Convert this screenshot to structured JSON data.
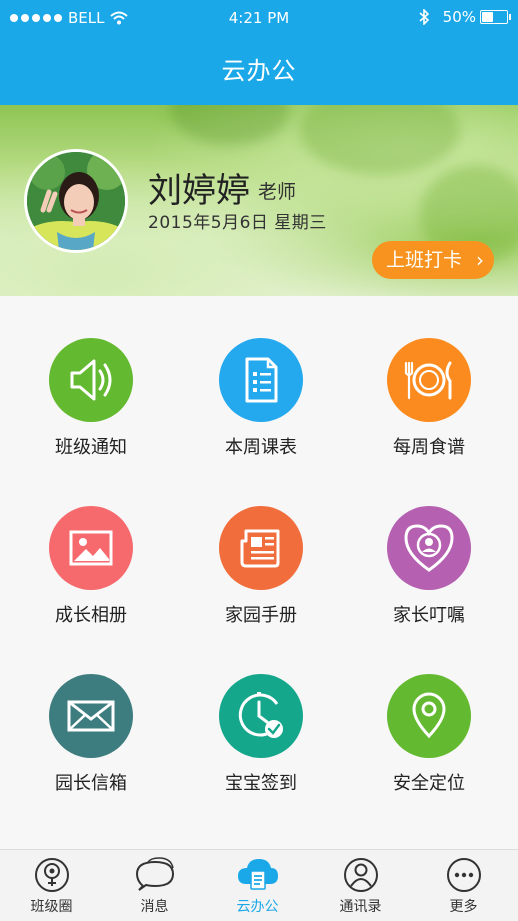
{
  "status_bar": {
    "carrier": "BELL",
    "time": "4:21 PM",
    "battery": "50%",
    "battery_level": 0.5
  },
  "header": {
    "title": "云办公"
  },
  "profile": {
    "name": "刘婷婷",
    "role": "老师",
    "date": "2015年5月6日  星期三",
    "clock_in_label": "上班打卡"
  },
  "colors": {
    "primary": "#1aa8e8",
    "orange": "#f7931e"
  },
  "grid": [
    {
      "label": "班级通知",
      "icon": "speaker-icon",
      "color": "#63b92f"
    },
    {
      "label": "本周课表",
      "icon": "document-list-icon",
      "color": "#25a9ee"
    },
    {
      "label": "每周食谱",
      "icon": "plate-cutlery-icon",
      "color": "#fb8b1e"
    },
    {
      "label": "成长相册",
      "icon": "image-icon",
      "color": "#f66a6d"
    },
    {
      "label": "家园手册",
      "icon": "newspaper-icon",
      "color": "#f16d3c"
    },
    {
      "label": "家长叮嘱",
      "icon": "heart-person-icon",
      "color": "#b560b0"
    },
    {
      "label": "园长信箱",
      "icon": "envelope-icon",
      "color": "#3e7d7f"
    },
    {
      "label": "宝宝签到",
      "icon": "clock-check-icon",
      "color": "#15a78c"
    },
    {
      "label": "安全定位",
      "icon": "location-pin-icon",
      "color": "#63b92f"
    }
  ],
  "tabs": [
    {
      "label": "班级圈",
      "icon": "class-circle-icon"
    },
    {
      "label": "消息",
      "icon": "chat-bubble-icon"
    },
    {
      "label": "云办公",
      "icon": "cloud-office-icon",
      "active": true
    },
    {
      "label": "通讯录",
      "icon": "contacts-icon"
    },
    {
      "label": "更多",
      "icon": "more-icon"
    }
  ]
}
